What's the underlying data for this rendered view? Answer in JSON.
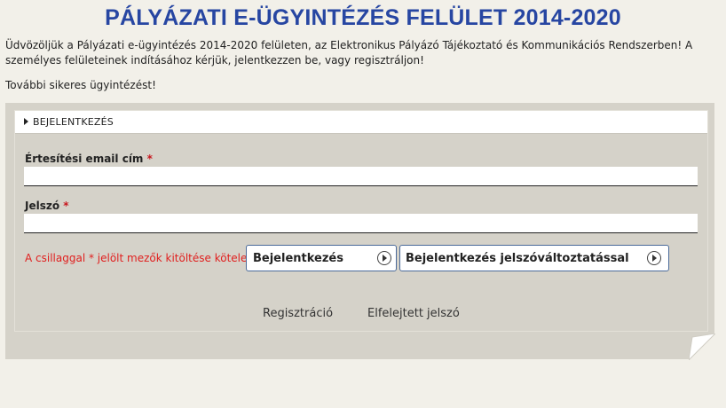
{
  "page": {
    "title": "PÁLYÁZATI E-ÜGYINTÉZÉS FELÜLET 2014-2020",
    "intro": "Üdvözöljük a Pályázati e-ügyintézés 2014-2020 felületen, az Elektronikus Pályázó Tájékoztató és Kommunikációs Rendszerben! A személyes felületeinek indításához kérjük, jelentkezzen be, vagy regisztráljon!",
    "tagline": "További sikeres ügyintézést!"
  },
  "login": {
    "section_label": "BEJELENTKEZÉS",
    "email_label": "Értesítési email cím",
    "email_value": "",
    "password_label": "Jelszó",
    "password_value": "",
    "required_mark": "*",
    "required_note": "A csillaggal * jelölt mezők kitöltése kötelező.",
    "login_button": "Bejelentkezés",
    "login_change_pw_button": "Bejelentkezés jelszóváltoztatással",
    "register_link": "Regisztráció",
    "forgot_link": "Elfelejtett jelszó"
  },
  "colors": {
    "title": "#2746a2",
    "panel": "#d5d2c9",
    "background": "#f2f0e9",
    "required": "#e0201f",
    "button_border": "#4a6a9a"
  },
  "icons": {
    "section_toggle": "triangle-right-icon",
    "button_arrow": "circle-arrow-right-icon"
  }
}
